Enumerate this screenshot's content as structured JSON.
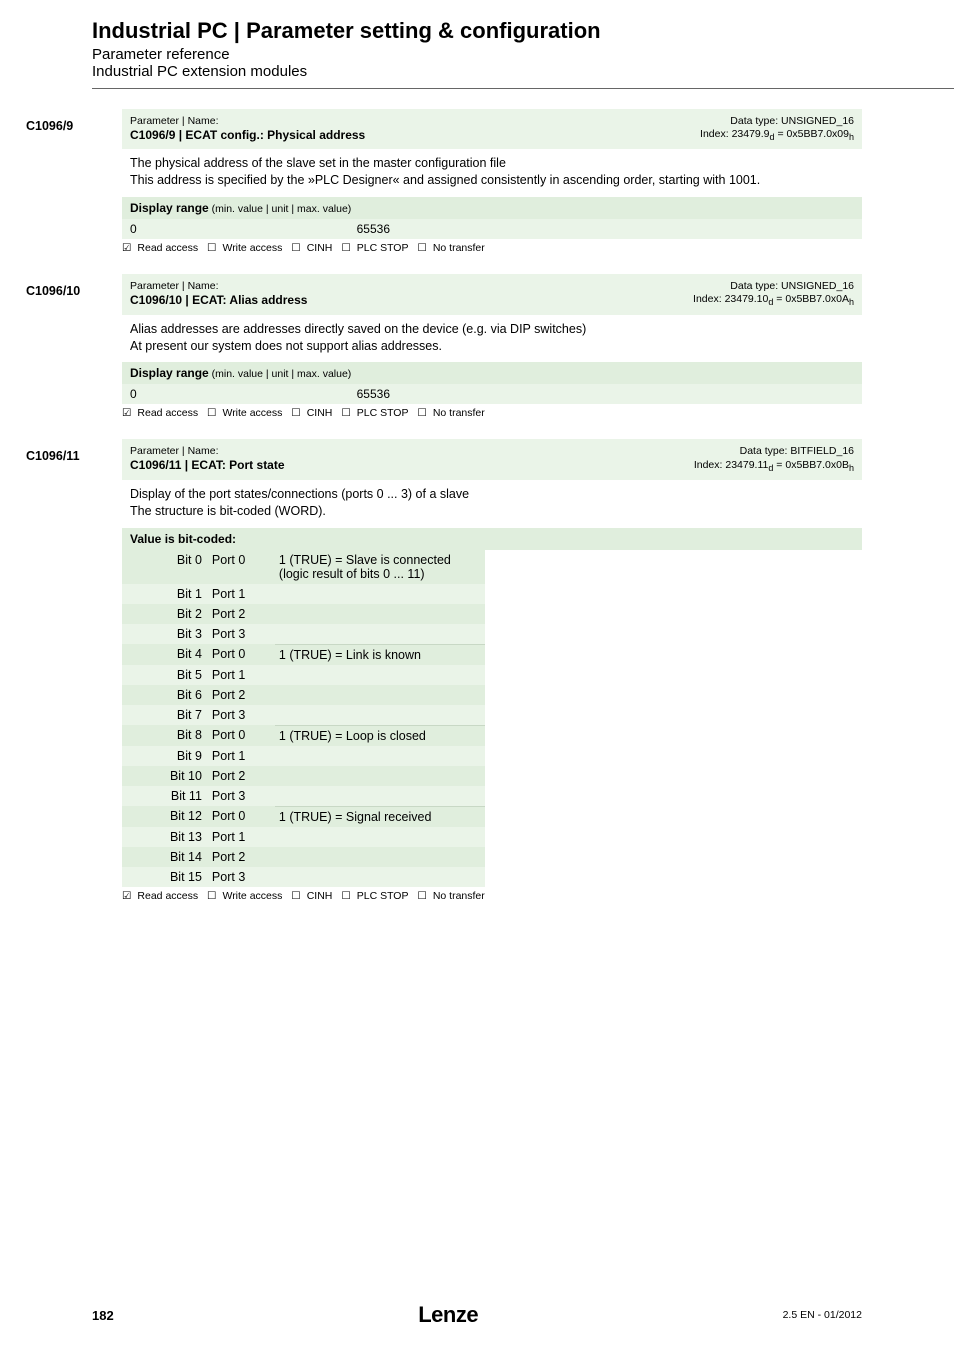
{
  "header": {
    "title": "Industrial PC | Parameter setting & configuration",
    "subtitle1": "Parameter reference",
    "subtitle2": "Industrial PC extension modules"
  },
  "glyphs": {
    "checked": "☑",
    "unchecked": "☐"
  },
  "access_labels": {
    "read": "Read access",
    "write": "Write access",
    "cinh": "CINH",
    "plc": "PLC STOP",
    "notransfer": "No transfer"
  },
  "range_heading": "Display range",
  "range_sub": " (min. value | unit | max. value)",
  "sections": {
    "s1": {
      "anchor": "C1096/9",
      "param_label": "Parameter | Name:",
      "name": "C1096/9 | ECAT config.: Physical address",
      "dt": "Data type: UNSIGNED_16",
      "idx": "Index: 23479.9",
      "idx_sub": "d",
      "idx_tail": " = 0x5BB7.0x09",
      "idx_tail_sub": "h",
      "desc1": "The physical address of the slave set in the master configuration file",
      "desc2": "This address is specified by the »PLC Designer« and assigned consistently in ascending order, starting with 1001.",
      "min": "0",
      "max": "65536"
    },
    "s2": {
      "anchor": "C1096/10",
      "param_label": "Parameter | Name:",
      "name": "C1096/10 | ECAT: Alias address",
      "dt": "Data type: UNSIGNED_16",
      "idx": "Index: 23479.10",
      "idx_sub": "d",
      "idx_tail": " = 0x5BB7.0x0A",
      "idx_tail_sub": "h",
      "desc1": "Alias addresses are addresses directly saved on the device (e.g. via DIP switches)",
      "desc2": "At present our system does not support alias addresses.",
      "min": "0",
      "max": "65536"
    },
    "s3": {
      "anchor": "C1096/11",
      "param_label": "Parameter | Name:",
      "name": "C1096/11 | ECAT: Port state",
      "dt": "Data type: BITFIELD_16",
      "idx": "Index: 23479.11",
      "idx_sub": "d",
      "idx_tail": " = 0x5BB7.0x0B",
      "idx_tail_sub": "h",
      "desc1": "Display of the port states/connections (ports 0 ... 3) of a slave",
      "desc2": "The structure is bit-coded (WORD).",
      "bit_heading": "Value is bit-coded:",
      "meanings": {
        "m0": "1 (TRUE) = Slave is connected (logic result of bits 0 ... 11)",
        "m1": "1 (TRUE) = Link is known",
        "m2": "1 (TRUE) = Loop is closed",
        "m3": "1 (TRUE) = Signal received"
      },
      "bits": [
        {
          "b": "Bit 0",
          "p": "Port 0"
        },
        {
          "b": "Bit 1",
          "p": "Port 1"
        },
        {
          "b": "Bit 2",
          "p": "Port 2"
        },
        {
          "b": "Bit 3",
          "p": "Port 3"
        },
        {
          "b": "Bit 4",
          "p": "Port 0"
        },
        {
          "b": "Bit 5",
          "p": "Port 1"
        },
        {
          "b": "Bit 6",
          "p": "Port 2"
        },
        {
          "b": "Bit 7",
          "p": "Port 3"
        },
        {
          "b": "Bit 8",
          "p": "Port 0"
        },
        {
          "b": "Bit 9",
          "p": "Port 1"
        },
        {
          "b": "Bit 10",
          "p": "Port 2"
        },
        {
          "b": "Bit 11",
          "p": "Port 3"
        },
        {
          "b": "Bit 12",
          "p": "Port 0"
        },
        {
          "b": "Bit 13",
          "p": "Port 1"
        },
        {
          "b": "Bit 14",
          "p": "Port 2"
        },
        {
          "b": "Bit 15",
          "p": "Port 3"
        }
      ]
    }
  },
  "footer": {
    "page": "182",
    "logo": "Lenze",
    "rev": "2.5 EN - 01/2012"
  }
}
